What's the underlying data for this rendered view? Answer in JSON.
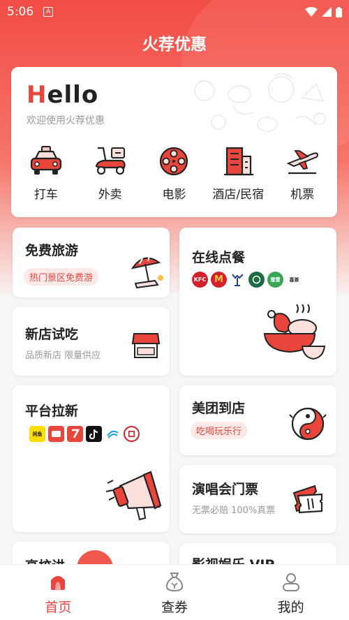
{
  "status": {
    "time": "5:06",
    "a_badge": "A"
  },
  "header": {
    "title": "火荐优惠"
  },
  "hello": {
    "title_first": "H",
    "title_rest": "ello",
    "subtitle": "欢迎使用火荐优惠",
    "services": [
      {
        "label": "打车",
        "icon": "taxi-icon"
      },
      {
        "label": "外卖",
        "icon": "scooter-icon"
      },
      {
        "label": "电影",
        "icon": "film-reel-icon"
      },
      {
        "label": "酒店/民宿",
        "icon": "hotel-icon"
      },
      {
        "label": "机票",
        "icon": "airplane-icon"
      }
    ]
  },
  "tiles": {
    "free_travel": {
      "title": "免费旅游",
      "tag": "热门景区免费游"
    },
    "online_order": {
      "title": "在线点餐",
      "brands": [
        "KFC",
        "M",
        "",
        "",
        "蜜雪",
        "喜茶"
      ]
    },
    "new_store": {
      "title": "新店试吃",
      "subtitle": "品质新店 限量供应"
    },
    "platform_new": {
      "title": "平台拉新",
      "brands": [
        "闲鱼",
        "",
        "",
        "",
        "",
        ""
      ]
    },
    "meituan": {
      "title": "美团到店",
      "tag": "吃喝玩乐行"
    },
    "concert": {
      "title": "演唱会门票",
      "subtitle": "无票必赔 100%真票"
    },
    "partial_left": {
      "title": "高校讲"
    },
    "partial_right": {
      "title": "影视娱乐 VIP"
    }
  },
  "colors": {
    "accent": "#e8453c",
    "tag_bg": "#fde9e7"
  },
  "nav": [
    {
      "label": "首页",
      "icon": "home-icon",
      "active": true
    },
    {
      "label": "查券",
      "icon": "coupon-bag-icon",
      "active": false
    },
    {
      "label": "我的",
      "icon": "user-icon",
      "active": false
    }
  ]
}
